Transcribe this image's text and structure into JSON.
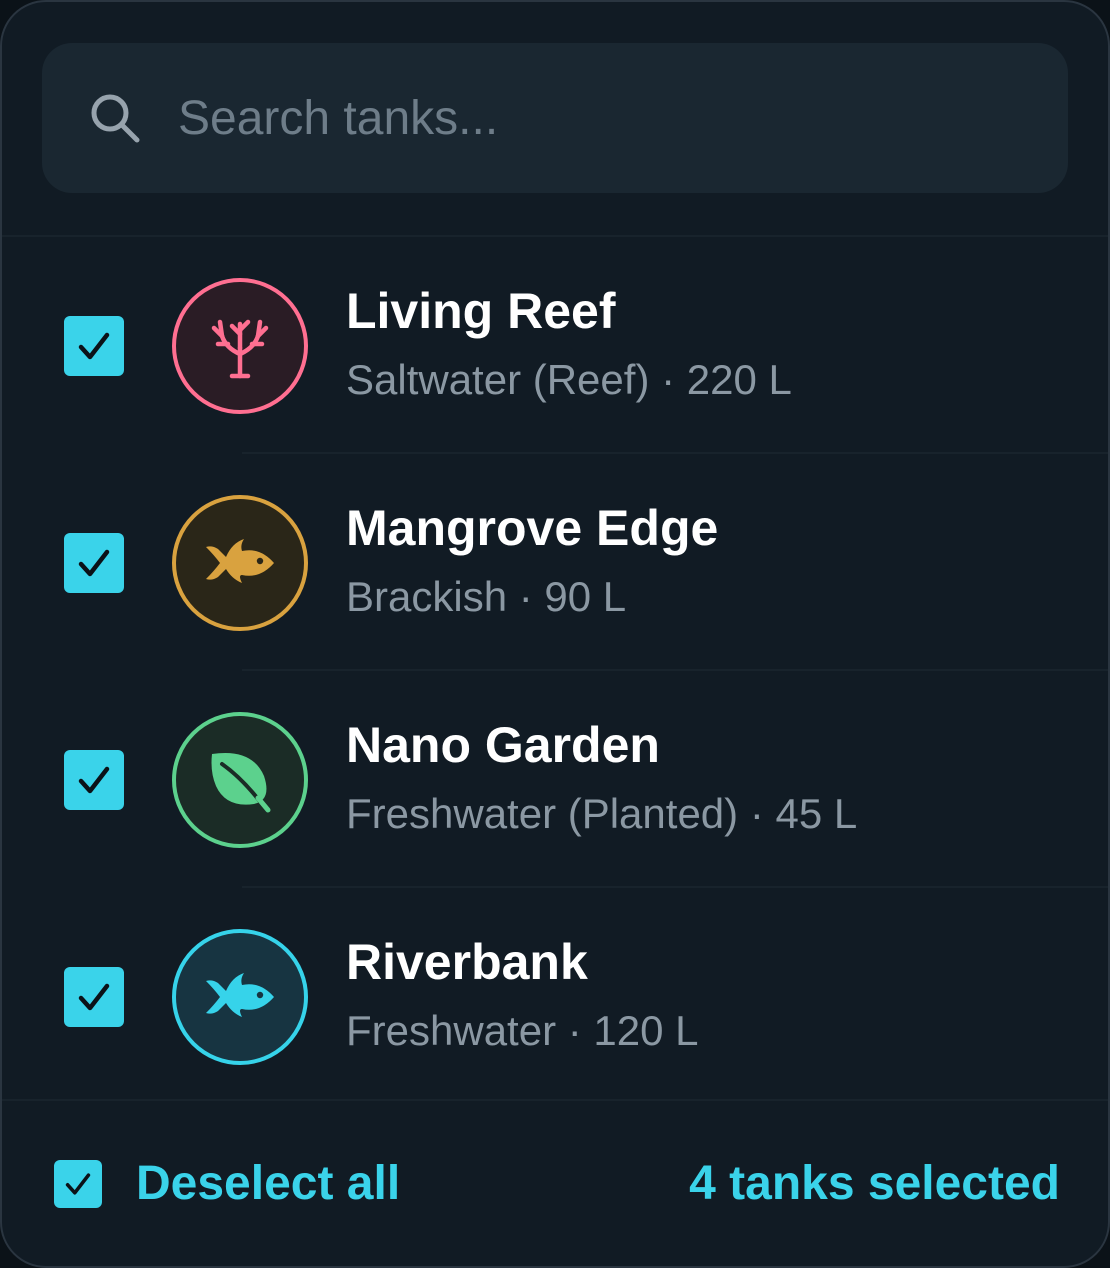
{
  "search": {
    "placeholder": "Search tanks...",
    "value": ""
  },
  "tanks": [
    {
      "name": "Living Reef",
      "subtitle": "Saltwater (Reef) · 220 L",
      "icon": "coral-icon",
      "color": "#ff6f91",
      "bg": "#2a1c25",
      "checked": true
    },
    {
      "name": "Mangrove Edge",
      "subtitle": "Brackish · 90 L",
      "icon": "fish-icon",
      "color": "#d9a23f",
      "bg": "#2a2618",
      "checked": true
    },
    {
      "name": "Nano Garden",
      "subtitle": "Freshwater (Planted) · 45 L",
      "icon": "leaf-icon",
      "color": "#5cd18d",
      "bg": "#1b2c26",
      "checked": true
    },
    {
      "name": "Riverbank",
      "subtitle": "Freshwater · 120 L",
      "icon": "fish-icon",
      "color": "#36d3ea",
      "bg": "#173441",
      "checked": true
    }
  ],
  "footer": {
    "deselect_label": "Deselect all",
    "selected_count_label": "4 tanks selected"
  },
  "colors": {
    "accent": "#3ad3ea",
    "panel": "#111b24",
    "search_bg": "#1a2731"
  }
}
